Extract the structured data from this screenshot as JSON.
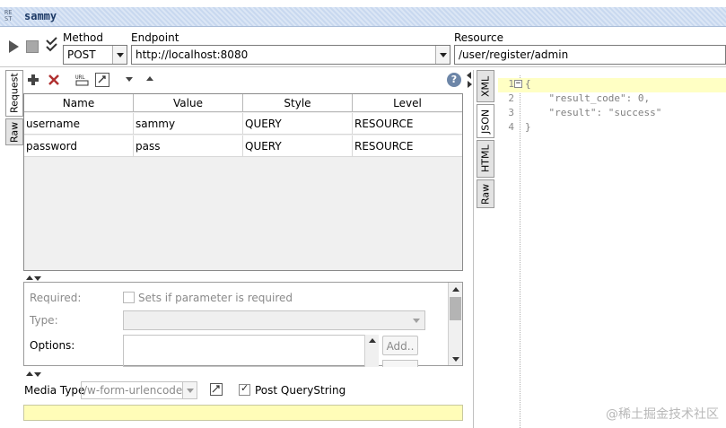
{
  "window": {
    "title": "sammy",
    "rest_icon_text": "RE\nST"
  },
  "toolbar": {
    "method_label": "Method",
    "method_value": "POST",
    "endpoint_label": "Endpoint",
    "endpoint_value": "http://localhost:8080",
    "resource_label": "Resource",
    "resource_value": "/user/register/admin"
  },
  "request_tabs": [
    {
      "label": "Request"
    },
    {
      "label": "Raw"
    }
  ],
  "params": {
    "columns": [
      "Name",
      "Value",
      "Style",
      "Level"
    ],
    "rows": [
      [
        "username",
        "sammy",
        "QUERY",
        "RESOURCE"
      ],
      [
        "password",
        "pass",
        "QUERY",
        "RESOURCE"
      ]
    ]
  },
  "param_form": {
    "required_label": "Required:",
    "required_checkbox_label": "Sets if parameter is required",
    "type_label": "Type:",
    "options_label": "Options:",
    "add_button": "Add.."
  },
  "media": {
    "label": "Media Type",
    "value": "/w-form-urlencoded",
    "post_query_label": "Post QueryString"
  },
  "response_tabs": [
    {
      "label": "XML"
    },
    {
      "label": "JSON"
    },
    {
      "label": "HTML"
    },
    {
      "label": "Raw"
    }
  ],
  "response_code": [
    {
      "n": "1",
      "text": "{"
    },
    {
      "n": "2",
      "text": "    \"result_code\": 0,"
    },
    {
      "n": "3",
      "text": "    \"result\": \"success\""
    },
    {
      "n": "4",
      "text": "}"
    }
  ],
  "watermark": "@稀土掘金技术社区",
  "colors": {
    "title_bg": "#dbe6f5",
    "highlight": "#ffffc4",
    "yellow_bar": "#fffdb8"
  }
}
